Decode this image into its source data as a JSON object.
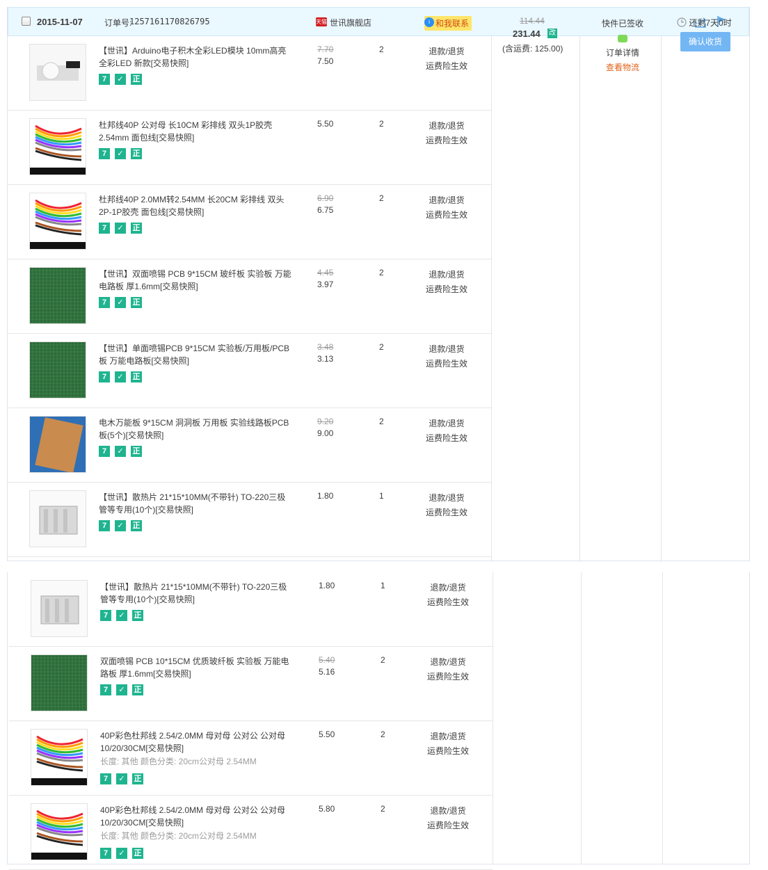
{
  "order": {
    "date": "2015-11-07",
    "order_no_label": "订单号:",
    "order_no": "1257161170826795",
    "shop_tag": "天猫",
    "shop": "世讯旗舰店",
    "contact": "和我联系",
    "contact_dot": "i",
    "total_old": "114.44",
    "total": "231.44",
    "total_tag": "改",
    "shipping": "(含运费: 125.00)",
    "status": "快件已签收",
    "detail": "订单详情",
    "logistics": "查看物流",
    "remaining": "还剩7天0时",
    "confirm": "确认收货"
  },
  "refund": {
    "line1": "退款/退货",
    "line2": "运费险生效"
  },
  "badges": {
    "seven": "7",
    "shield": "✓",
    "genuine": "正"
  },
  "items_top": [
    {
      "title": "【世讯】Arduino电子积木全彩LED模块 10mm高亮全彩LED 新款[交易快照]",
      "price_old": "7.70",
      "price": "7.50",
      "qty": "2",
      "thumb": "led"
    },
    {
      "title": "杜邦线40P 公对母 长10CM 彩排线 双头1P胶壳 2.54mm 面包线[交易快照]",
      "price_old": "",
      "price": "5.50",
      "qty": "2",
      "thumb": "wire"
    },
    {
      "title": "杜邦线40P 2.0MM转2.54MM 长20CM 彩排线 双头2P-1P胶壳 面包线[交易快照]",
      "price_old": "6.90",
      "price": "6.75",
      "qty": "2",
      "thumb": "wire"
    },
    {
      "title": "【世讯】双面喷锡 PCB 9*15CM 玻纤板 实验板 万能电路板 厚1.6mm[交易快照]",
      "price_old": "4.45",
      "price": "3.97",
      "qty": "2",
      "thumb": "pcb"
    },
    {
      "title": "【世讯】单面喷锡PCB 9*15CM 实验板/万用板/PCB板 万能电路板[交易快照]",
      "price_old": "3.48",
      "price": "3.13",
      "qty": "2",
      "thumb": "pcb"
    },
    {
      "title": "电木万能板 9*15CM 洞洞板 万用板 实验线路板PCB板(5个)[交易快照]",
      "price_old": "9.20",
      "price": "9.00",
      "qty": "2",
      "thumb": "bakelite"
    },
    {
      "title": "【世讯】散热片 21*15*10MM(不带针) TO-220三极管等专用(10个)[交易快照]",
      "price_old": "",
      "price": "1.80",
      "qty": "1",
      "thumb": "heatsink"
    }
  ],
  "items_bottom": [
    {
      "title": "【世讯】散热片 21*15*10MM(不带针) TO-220三极管等专用(10个)[交易快照]",
      "price_old": "",
      "price": "1.80",
      "qty": "1",
      "thumb": "heatsink"
    },
    {
      "title": "双面喷锡 PCB 10*15CM 优质玻纤板 实验板 万能电路板 厚1.6mm[交易快照]",
      "price_old": "5.40",
      "price": "5.16",
      "qty": "2",
      "thumb": "pcb"
    },
    {
      "title": "40P彩色杜邦线 2.54/2.0MM 母对母 公对公 公对母 10/20/30CM[交易快照]",
      "sku": "长度: 其他  颜色分类: 20cm公对母 2.54MM",
      "price_old": "",
      "price": "5.50",
      "qty": "2",
      "thumb": "wire2"
    },
    {
      "title": "40P彩色杜邦线 2.54/2.0MM 母对母 公对公 公对母 10/20/30CM[交易快照]",
      "sku": "长度: 其他  颜色分类: 20cm公对母 2.54MM",
      "price_old": "",
      "price": "5.80",
      "qty": "2",
      "thumb": "wire2"
    }
  ]
}
